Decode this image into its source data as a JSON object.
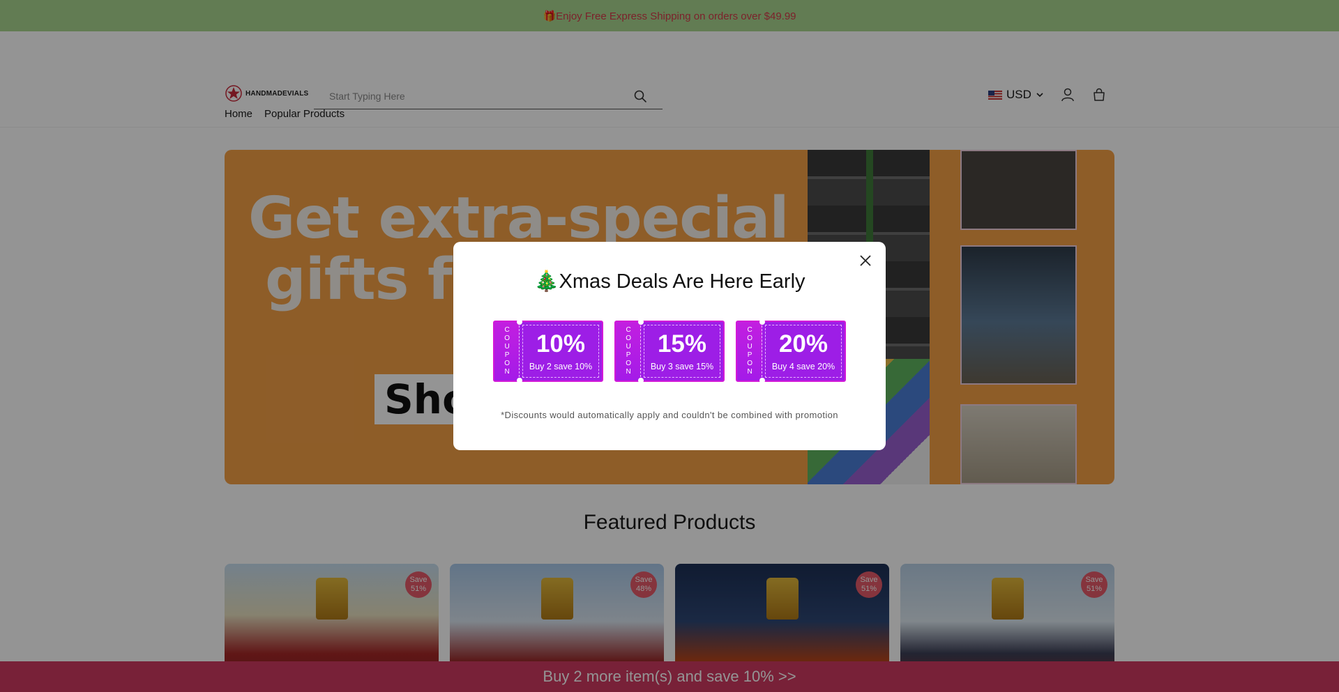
{
  "announcement": {
    "text": "🎁Enjoy Free Express Shipping on orders over $49.99"
  },
  "header": {
    "logo_text": "HANDMADEVIALS",
    "search_placeholder": "Start Typing Here",
    "currency": "USD",
    "icons": {
      "search": "search-icon",
      "user": "user-icon",
      "cart": "shopping-bag-icon",
      "flag": "us-flag-icon"
    }
  },
  "nav": {
    "items": [
      "Home",
      "Popular Products"
    ]
  },
  "hero": {
    "headline_line1": "Get extra-special",
    "headline_line2": "gifts fo",
    "cta_text": "Sho"
  },
  "featured": {
    "title": "Featured Products",
    "cards": [
      {
        "save_label": "Save",
        "save_pct": "51%"
      },
      {
        "save_label": "Save",
        "save_pct": "48%"
      },
      {
        "save_label": "Save",
        "save_pct": "51%"
      },
      {
        "save_label": "Save",
        "save_pct": "51%"
      }
    ]
  },
  "sticky_bar": {
    "text": "Buy 2 more item(s) and save 10%  >>"
  },
  "modal": {
    "title": "🎄Xmas Deals Are Here Early",
    "coupon_side_text": "COUPON",
    "coupons": [
      {
        "percent": "10%",
        "description": "Buy 2 save 10%"
      },
      {
        "percent": "15%",
        "description": "Buy 3 save 15%"
      },
      {
        "percent": "20%",
        "description": "Buy 4 save 20%"
      }
    ],
    "note": "*Discounts would automatically apply and couldn't be combined with promotion"
  },
  "colors": {
    "announcement_bg": "#a9d68f",
    "announcement_text": "#d63a4a",
    "coupon_bg": "#9d1ee6",
    "coupon_border": "#d21ad8",
    "sticky_bar_bg": "#cf3a61",
    "save_badge_bg": "#e65b6a"
  }
}
